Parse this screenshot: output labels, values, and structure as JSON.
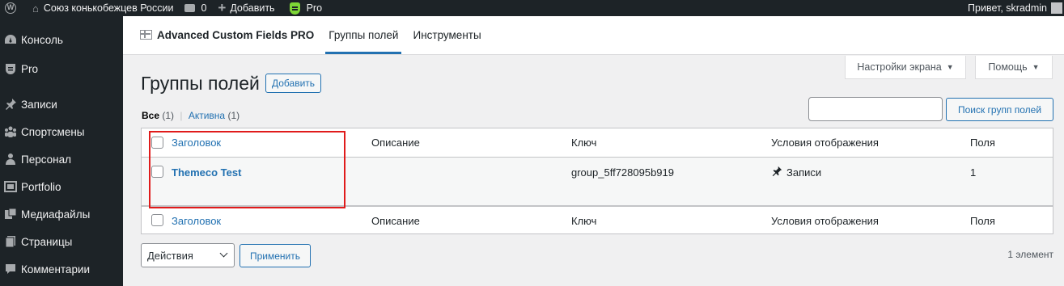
{
  "admin_bar": {
    "wp_logo_icon": "wordpress-icon",
    "site_name": "Союз конькобежцев России",
    "comments_count": "0",
    "new_label": "Добавить",
    "pro_label": "Pro",
    "greeting": "Привет, skradmin"
  },
  "sidebar": {
    "items": [
      {
        "label": "Консоль",
        "icon": "dashboard-icon"
      },
      {
        "label": "Pro",
        "icon": "pro-shield-icon"
      },
      {
        "label": "Записи",
        "icon": "pin-icon"
      },
      {
        "label": "Спортсмены",
        "icon": "groups-icon"
      },
      {
        "label": "Персонал",
        "icon": "staff-icon"
      },
      {
        "label": "Portfolio",
        "icon": "portfolio-icon"
      },
      {
        "label": "Медиафайлы",
        "icon": "media-icon"
      },
      {
        "label": "Страницы",
        "icon": "pages-icon"
      },
      {
        "label": "Комментарии",
        "icon": "comments-icon"
      }
    ]
  },
  "acf": {
    "brand": "Advanced Custom Fields PRO",
    "tabs": [
      {
        "label": "Группы полей",
        "active": true
      },
      {
        "label": "Инструменты",
        "active": false
      }
    ]
  },
  "screen_options": {
    "screen_label": "Настройки экрана",
    "help_label": "Помощь"
  },
  "page": {
    "title": "Группы полей",
    "add_new": "Добавить"
  },
  "filters": {
    "all_label": "Все",
    "all_count": "(1)",
    "separator": "|",
    "active_label": "Активна",
    "active_count": "(1)"
  },
  "search": {
    "value": "",
    "button_label": "Поиск групп полей"
  },
  "table": {
    "columns": [
      "Заголовок",
      "Описание",
      "Ключ",
      "Условия отображения",
      "Поля"
    ],
    "rows": [
      {
        "title": "Themeco Test",
        "description": "",
        "key": "group_5ff728095b919",
        "location": "Записи",
        "fields": "1"
      }
    ]
  },
  "bulk": {
    "selected": "Действия",
    "apply_label": "Применить",
    "items_count": "1 элемент"
  },
  "colors": {
    "accent": "#2271b1",
    "admin_bar_bg": "#1d2327",
    "highlight_box": "#e01b1b"
  }
}
